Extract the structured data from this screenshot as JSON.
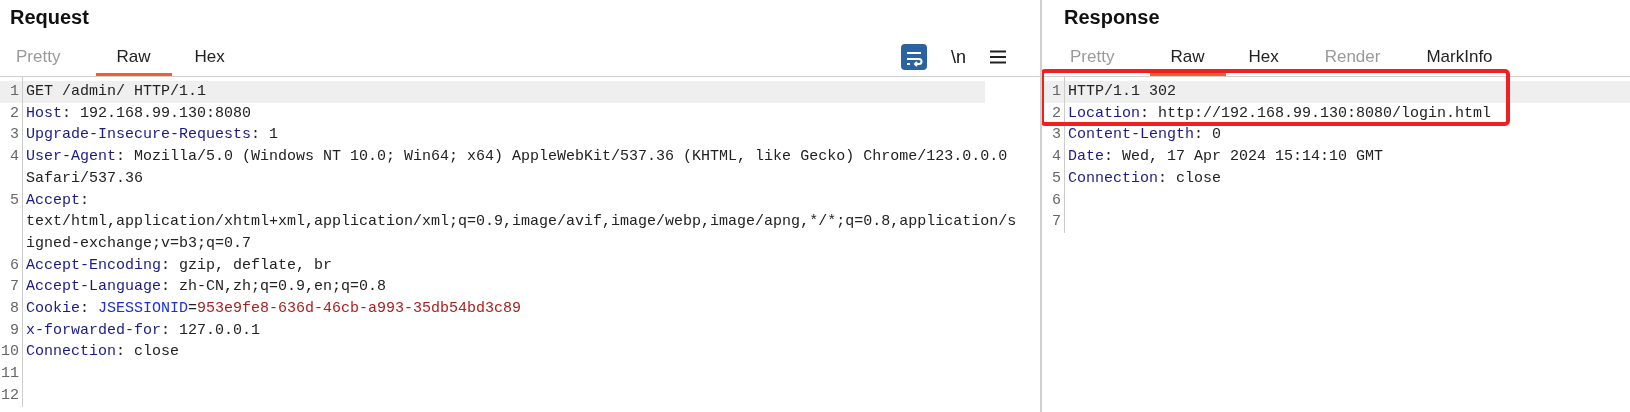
{
  "panels": [
    {
      "title": "Request",
      "tabs": [
        {
          "label": "Pretty",
          "selected": false,
          "disabled": true
        },
        {
          "label": "Raw",
          "selected": true,
          "disabled": false
        },
        {
          "label": "Hex",
          "selected": false,
          "disabled": false
        }
      ],
      "toolbar": {
        "wrap_on": true,
        "newline_label": "\\n"
      },
      "lines": [
        {
          "number": "1",
          "highlighted": true,
          "rows": [
            [
              {
                "kind": "plain",
                "text": "GET /admin/ HTTP/1.1"
              }
            ]
          ]
        },
        {
          "number": "2",
          "highlighted": false,
          "rows": [
            [
              {
                "kind": "key",
                "text": "Host"
              },
              {
                "kind": "plain",
                "text": ": 192.168.99.130:8080"
              }
            ]
          ]
        },
        {
          "number": "3",
          "highlighted": false,
          "rows": [
            [
              {
                "kind": "key",
                "text": "Upgrade-Insecure-Requests"
              },
              {
                "kind": "plain",
                "text": ": 1"
              }
            ]
          ]
        },
        {
          "number": "4",
          "highlighted": false,
          "rows": [
            [
              {
                "kind": "key",
                "text": "User-Agent"
              },
              {
                "kind": "plain",
                "text": ": Mozilla/5.0 (Windows NT 10.0; Win64; x64) AppleWebKit/537.36 (KHTML, like Gecko) Chrome/123.0.0.0"
              }
            ],
            [
              {
                "kind": "plain",
                "text": "Safari/537.36"
              }
            ]
          ]
        },
        {
          "number": "5",
          "highlighted": false,
          "rows": [
            [
              {
                "kind": "key",
                "text": "Accept"
              },
              {
                "kind": "plain",
                "text": ":"
              }
            ],
            [
              {
                "kind": "plain",
                "text": "text/html,application/xhtml+xml,application/xml;q=0.9,image/avif,image/webp,image/apng,*/*;q=0.8,application/s"
              }
            ],
            [
              {
                "kind": "plain",
                "text": "igned-exchange;v=b3;q=0.7"
              }
            ]
          ]
        },
        {
          "number": "6",
          "highlighted": false,
          "rows": [
            [
              {
                "kind": "key",
                "text": "Accept-Encoding"
              },
              {
                "kind": "plain",
                "text": ": gzip, deflate, br"
              }
            ]
          ]
        },
        {
          "number": "7",
          "highlighted": false,
          "rows": [
            [
              {
                "kind": "key",
                "text": "Accept-Language"
              },
              {
                "kind": "plain",
                "text": ": zh-CN,zh;q=0.9,en;q=0.8"
              }
            ]
          ]
        },
        {
          "number": "8",
          "highlighted": false,
          "rows": [
            [
              {
                "kind": "key",
                "text": "Cookie"
              },
              {
                "kind": "plain",
                "text": ": "
              },
              {
                "kind": "cookie-name",
                "text": "JSESSIONID"
              },
              {
                "kind": "plain",
                "text": "="
              },
              {
                "kind": "cookie-value",
                "text": "953e9fe8-636d-46cb-a993-35db54bd3c89"
              }
            ]
          ]
        },
        {
          "number": "9",
          "highlighted": false,
          "rows": [
            [
              {
                "kind": "key",
                "text": "x-forwarded-for"
              },
              {
                "kind": "plain",
                "text": ": 127.0.0.1"
              }
            ]
          ]
        },
        {
          "number": "10",
          "highlighted": false,
          "rows": [
            [
              {
                "kind": "key",
                "text": "Connection"
              },
              {
                "kind": "plain",
                "text": ": close"
              }
            ]
          ]
        },
        {
          "number": "11",
          "highlighted": false,
          "rows": [
            []
          ]
        },
        {
          "number": "12",
          "highlighted": false,
          "rows": [
            []
          ]
        }
      ]
    },
    {
      "title": "Response",
      "tabs": [
        {
          "label": "Pretty",
          "selected": false,
          "disabled": true
        },
        {
          "label": "Raw",
          "selected": true,
          "disabled": false
        },
        {
          "label": "Hex",
          "selected": false,
          "disabled": false
        },
        {
          "label": "Render",
          "selected": false,
          "disabled": true
        },
        {
          "label": "MarkInfo",
          "selected": false,
          "disabled": false
        }
      ],
      "lines": [
        {
          "number": "1",
          "highlighted": true,
          "rows": [
            [
              {
                "kind": "plain",
                "text": "HTTP/1.1 302"
              }
            ]
          ]
        },
        {
          "number": "2",
          "highlighted": false,
          "rows": [
            [
              {
                "kind": "key",
                "text": "Location"
              },
              {
                "kind": "plain",
                "text": ": http://192.168.99.130:8080/login.html"
              }
            ]
          ]
        },
        {
          "number": "3",
          "highlighted": false,
          "rows": [
            [
              {
                "kind": "key",
                "text": "Content-Length"
              },
              {
                "kind": "plain",
                "text": ": 0"
              }
            ]
          ]
        },
        {
          "number": "4",
          "highlighted": false,
          "rows": [
            [
              {
                "kind": "key",
                "text": "Date"
              },
              {
                "kind": "plain",
                "text": ": Wed, 17 Apr 2024 15:14:10 GMT"
              }
            ]
          ]
        },
        {
          "number": "5",
          "highlighted": false,
          "rows": [
            [
              {
                "kind": "key",
                "text": "Connection"
              },
              {
                "kind": "plain",
                "text": ": close"
              }
            ]
          ]
        },
        {
          "number": "6",
          "highlighted": false,
          "rows": [
            []
          ]
        },
        {
          "number": "7",
          "highlighted": false,
          "rows": [
            []
          ]
        }
      ],
      "annotation": {
        "kind": "box"
      }
    }
  ]
}
